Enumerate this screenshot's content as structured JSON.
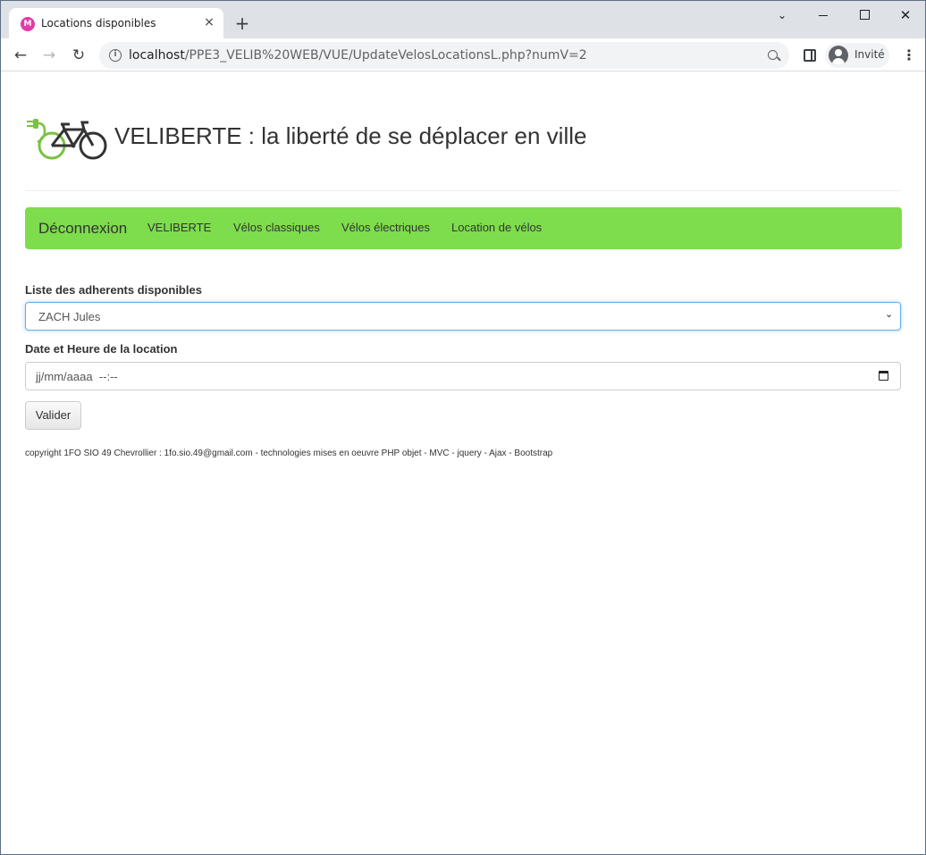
{
  "browser": {
    "tab_title": "Locations disponibles",
    "tab_close": "×",
    "new_tab": "+",
    "url_host": "localhost",
    "url_path": "/PPE3_VELIB%20WEB/VUE/UpdateVelosLocationsL.php?numV=2",
    "profile_label": "Invité",
    "favicon_letter": "M"
  },
  "header": {
    "title": "VELIBERTE : la liberté de se déplacer en ville"
  },
  "navbar": {
    "brand": "Déconnexion",
    "links": [
      "VELIBERTE",
      "Vélos classiques",
      "Vélos électriques",
      "Location de vélos"
    ],
    "color": "#7ddd4c"
  },
  "form": {
    "adherent_label": "Liste des adherents disponibles",
    "adherent_selected": "ZACH Jules",
    "date_label": "Date et Heure de la location",
    "date_placeholder": "jj/mm/aaaa  --:--",
    "submit_label": "Valider"
  },
  "footer": {
    "text": "copyright 1FO SIO 49 Chevrollier : 1fo.sio.49@gmail.com - technologies mises en oeuvre PHP objet - MVC - jquery - Ajax - Bootstrap"
  },
  "icons": {
    "logo": "electric-bike-logo",
    "calendar": "calendar-icon",
    "chevron": "chevron-down-icon"
  }
}
